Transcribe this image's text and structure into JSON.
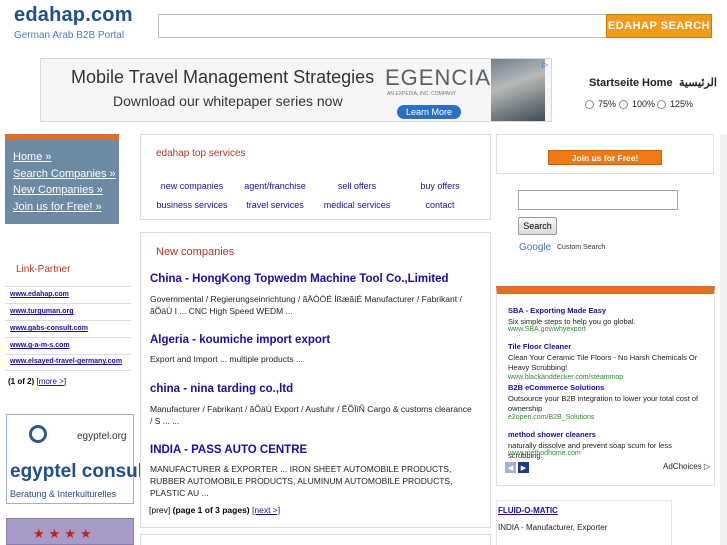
{
  "header": {
    "logo_title": "edahap.com",
    "logo_subtitle": "German Arab B2B Portal",
    "search_value": "",
    "search_button": "EDAHAP SEARCH"
  },
  "banner": {
    "line1": "Mobile Travel Management Strategies",
    "line2": "Download our whitepaper series now",
    "brand": "EGENCIA",
    "brand_sub": "AN EXPEDIA, INC. COMPANY",
    "cta": "Learn More"
  },
  "topnav": {
    "items": [
      "Startseite",
      "Home",
      "الرئيسية"
    ],
    "zoom_options": [
      "75%",
      "100%",
      "125%"
    ]
  },
  "leftnav": {
    "items": [
      "Home »",
      "Search Companies »",
      "New Companies »",
      "Join us for Free! »"
    ]
  },
  "link_partner": {
    "title": "Link-Partner",
    "links": [
      "www.edahap.com",
      "www.turguman.org",
      "www.gabs-consult.com",
      "www.g-a-m-s.com",
      "www.elsayed-travel-germany.com"
    ],
    "pager_status": "(1 of 2)",
    "pager_more": "more >"
  },
  "egyptel": {
    "domain": "egyptel.org",
    "name": "egyptel consult",
    "tagline": "Beratung & Interkulturelles"
  },
  "hotel_ad": {
    "stars": "★★★★"
  },
  "services": {
    "title": "edahap top services",
    "items": [
      "new companies",
      "agent/franchise",
      "sell offers",
      "buy offers",
      "business services",
      "travel services",
      "medical services",
      "contact"
    ]
  },
  "new_companies": {
    "title": "New companies",
    "companies": [
      {
        "name": "China - HongKong Topwedm Machine Tool Co.,Limited",
        "desc": "Governmental / Regierungseinrichtung / ãÄÓÓÉ ÍßæãíÉ  Manufacturer / Fabrikant / ãÕäÚ I ... CNC High Speed WEDM ..."
      },
      {
        "name": "Algeria - koumiche import export",
        "desc": "Export and Import ... multiple products ..."
      },
      {
        "name": "china - nina tarding co.,ltd",
        "desc": "Manufacturer / Fabrikant / ãÕäÚ   Export / Ausfuhr / ÊÕÏíÑ   Cargo & customs clearance / S ... ..."
      },
      {
        "name": "INDIA - PASS AUTO CENTRE",
        "desc": "MANUFACTURER & EXPORTER ... IRON SHEET AUTOMOBILE PRODUCTS, RUBBER AUTOMOBILE PRODUCTS, ALUMINUM AUTOMOBILE PRODUCTS, PLASTIC AU ..."
      }
    ],
    "pager_prev": "[prev]",
    "pager_status": "(page 1 of 3 pages)",
    "pager_next": "[next >]"
  },
  "right": {
    "join_button": "Join us for Free!",
    "google_search_button": "Search",
    "google_logo": "Google",
    "google_label": "Custom Search"
  },
  "ads": {
    "items": [
      {
        "title": "SBA - Exporting Made Easy",
        "text": "Six simple steps to help you go global.",
        "url": "www.SBA.gov/whyexport"
      },
      {
        "title": "Tile Floor Cleaner",
        "text": "Clean Your Ceramic Tile Floors - No Harsh Chemicals Or Heavy Scrubbing!",
        "url": "www.blackanddecker.com/steammop"
      },
      {
        "title": "B2B eCommerce Solutions",
        "text": "Outsource your B2B integration to lower your total cost of ownership",
        "url": "e2open.com/B2B_Solutions"
      },
      {
        "title": "method shower cleaners",
        "text": "naturally dissolve and prevent soap scum for less scrubbing.",
        "url": "www.methodhome.com"
      }
    ],
    "choices_label": "AdChoices"
  },
  "fluid": {
    "title": "FLUID-O-MATIC",
    "text": "INDIA - Manufacturer, Exporter"
  },
  "colors": {
    "accent_orange": "#e36e1f",
    "link_blue": "#1a0dab",
    "nav_panel": "#6c8aa3",
    "logo_blue": "#1f4f8f"
  }
}
